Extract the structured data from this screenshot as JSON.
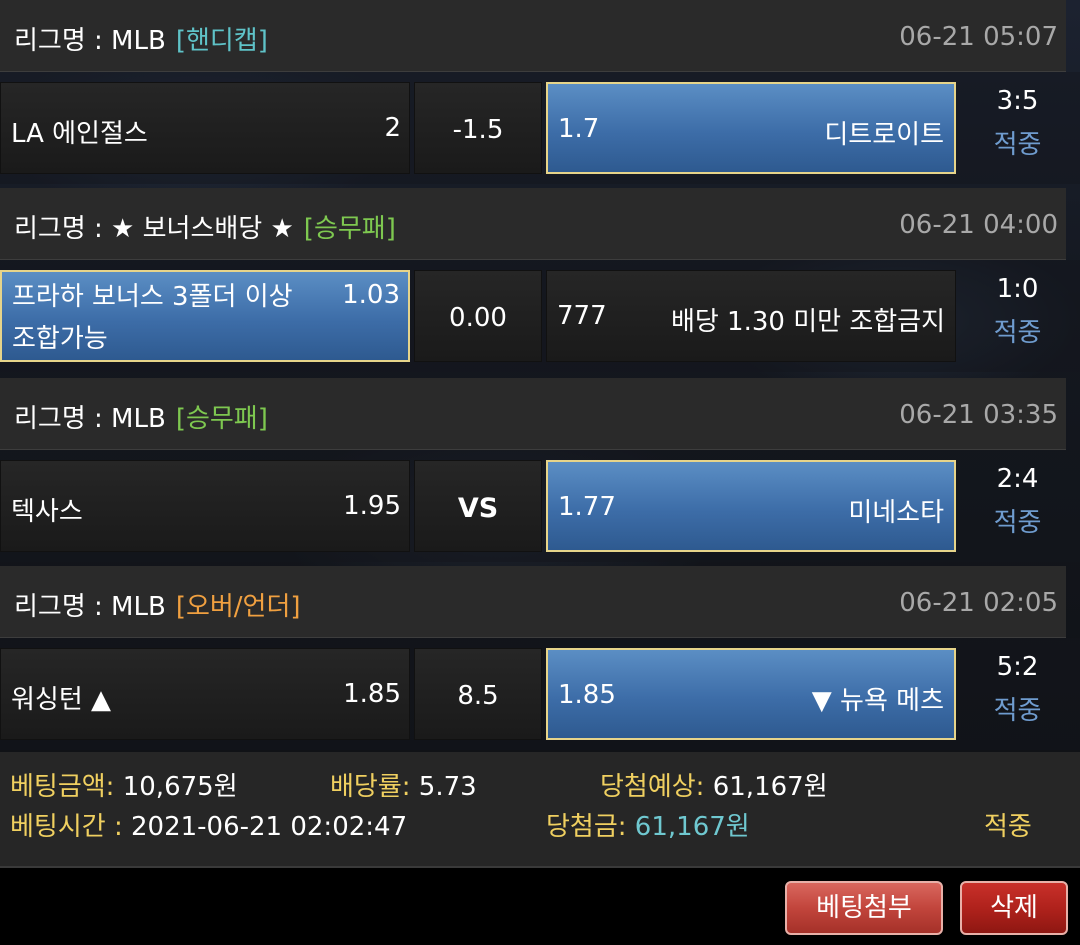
{
  "bets": [
    {
      "league_prefix": "리그명 : MLB",
      "bet_type": "[핸디캡]",
      "time": "06-21 05:07",
      "home_team": "LA 에인절스",
      "home_odds": "2",
      "mid": "-1.5",
      "away_odds": "1.7",
      "away_team": "디트로이트",
      "score": "3:5",
      "result": "적중"
    },
    {
      "league_prefix": "리그명 : ★ 보너스배당 ★",
      "bet_type": "[승무패]",
      "time": "06-21 04:00",
      "home_team_line1": "프라하 보너스 3폴더 이상",
      "home_team_line2": "조합가능",
      "home_odds": "1.03",
      "mid": "0.00",
      "away_odds": "777",
      "away_team": "배당 1.30 미만 조합금지",
      "score": "1:0",
      "result": "적중"
    },
    {
      "league_prefix": "리그명 : MLB",
      "bet_type": "[승무패]",
      "time": "06-21 03:35",
      "home_team": "텍사스",
      "home_odds": "1.95",
      "mid": "VS",
      "away_odds": "1.77",
      "away_team": "미네소타",
      "score": "2:4",
      "result": "적중"
    },
    {
      "league_prefix": "리그명 : MLB",
      "bet_type": "[오버/언더]",
      "time": "06-21 02:05",
      "home_team": "워싱턴 ▲",
      "home_odds": "1.85",
      "mid": "8.5",
      "away_odds": "1.85",
      "away_team": "▼ 뉴욕 메츠",
      "score": "5:2",
      "result": "적중"
    }
  ],
  "summary": {
    "bet_amount_label": "베팅금액:",
    "bet_amount_value": "10,675원",
    "odds_rate_label": "배당률:",
    "odds_rate_value": "5.73",
    "expected_label": "당첨예상:",
    "expected_value": "61,167원",
    "bet_time_label": "베팅시간 :",
    "bet_time_value": "2021-06-21 02:02:47",
    "win_label": "당첨금:",
    "win_value": "61,167원",
    "status": "적중"
  },
  "buttons": {
    "attach_label": "베팅첨부",
    "delete_label": "삭제"
  },
  "colors": {
    "selected_cell": "#3d6da8",
    "selected_border": "#e6d48a",
    "result": "#6f9ccf",
    "handicap_tag": "#5fc3c8",
    "win_draw_lose_tag": "#7ec850",
    "over_under_tag": "#f0a040",
    "summary_label": "#f0d060",
    "button_red": "#c2453c"
  }
}
